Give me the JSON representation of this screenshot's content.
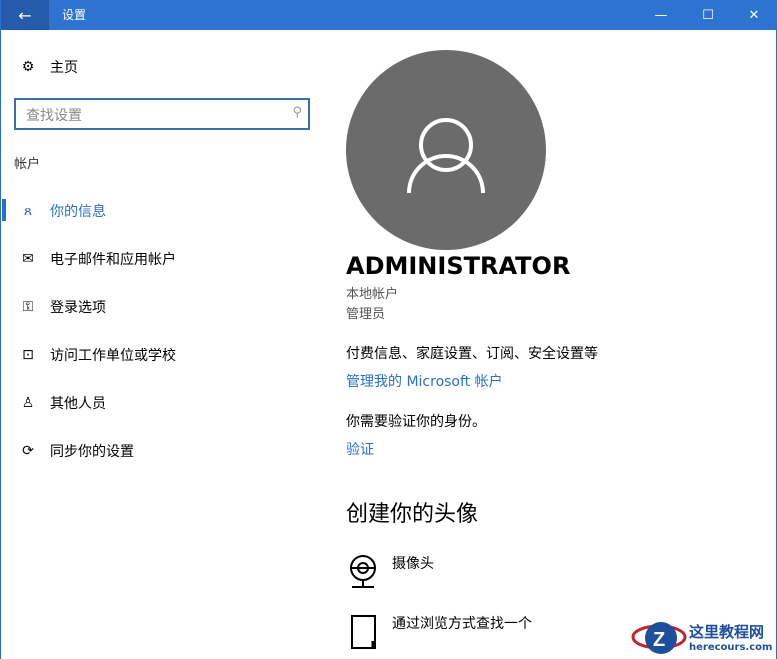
{
  "window": {
    "title": "设置",
    "back": "←",
    "minimize": "—",
    "maximize": "☐",
    "close": "✕"
  },
  "sidebar": {
    "home": "主页",
    "search_placeholder": "查找设置",
    "section": "帐户",
    "items": [
      {
        "label": "你的信息",
        "icon": "person-list-icon"
      },
      {
        "label": "电子邮件和应用帐户",
        "icon": "mail-icon"
      },
      {
        "label": "登录选项",
        "icon": "key-icon"
      },
      {
        "label": "访问工作单位或学校",
        "icon": "briefcase-icon"
      },
      {
        "label": "其他人员",
        "icon": "person-add-icon"
      },
      {
        "label": "同步你的设置",
        "icon": "sync-icon"
      }
    ]
  },
  "main": {
    "name": "ADMINISTRATOR",
    "account_type": "本地帐户",
    "role": "管理员",
    "billing": "付费信息、家庭设置、订阅、安全设置等",
    "manage_link": "管理我的 Microsoft 帐户",
    "verify_text": "你需要验证你的身份。",
    "verify_link": "验证",
    "create_heading": "创建你的头像",
    "camera": "摄像头",
    "browse": "通过浏览方式查找一个"
  },
  "watermark": {
    "name": "这里教程网",
    "url": "herecours.com"
  },
  "colors": {
    "accent": "#2e73cf"
  }
}
